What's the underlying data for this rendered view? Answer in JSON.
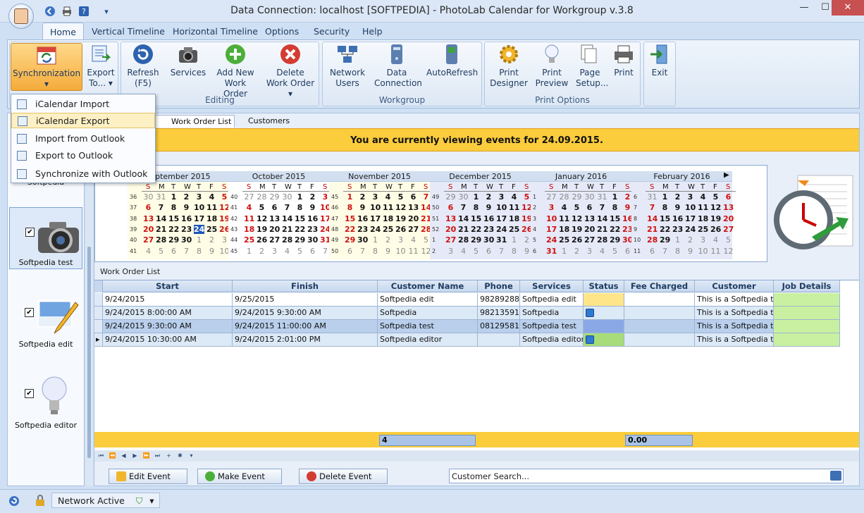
{
  "window": {
    "title": "Data Connection: localhost [SOFTPEDIA] - PhotoLab Calendar for Workgroup v.3.8",
    "minimize": "—",
    "maximize": "☐",
    "close": "✕"
  },
  "menu_tabs": [
    "Home",
    "Vertical Timeline",
    "Horizontal Timeline",
    "Options",
    "Security",
    "Help"
  ],
  "ribbon": {
    "buttons": {
      "sync": "Synchronization",
      "export": "Export To...",
      "refresh": "Refresh (F5)",
      "services": "Services",
      "add_work_order": "Add New Work Order",
      "delete_work_order": "Delete Work Order",
      "network_users": "Network Users",
      "data_connection": "Data Connection",
      "autorefresh": "AutoRefresh",
      "print_designer": "Print Designer",
      "print_preview": "Print Preview",
      "page_setup": "Page Setup...",
      "print": "Print",
      "exit": "Exit"
    },
    "groups": {
      "editing": "Editing",
      "workgroup": "Workgroup",
      "print_options": "Print Options"
    }
  },
  "dropdown": [
    "iCalendar Import",
    "iCalendar Export",
    "Import from Outlook",
    "Export to Outlook",
    "Synchronize with Outlook"
  ],
  "left_panel": [
    {
      "label": "Softpedia",
      "checked": true
    },
    {
      "label": "Softpedia test",
      "checked": true
    },
    {
      "label": "Softpedia edit",
      "checked": true
    },
    {
      "label": "Softpedia editor",
      "checked": true
    }
  ],
  "doc_tabs": [
    "Work Order List",
    "Customers"
  ],
  "banner": "You are currently viewing events for 24.09.2015.",
  "calendar": {
    "weekdays": [
      "S",
      "M",
      "T",
      "W",
      "T",
      "F",
      "S"
    ],
    "months": [
      {
        "name": "September 2015",
        "first_dow": 2,
        "days": 30,
        "first_week": 36,
        "prev_days": 31
      },
      {
        "name": "October 2015",
        "first_dow": 4,
        "days": 31,
        "first_week": 40,
        "prev_days": 30
      },
      {
        "name": "November 2015",
        "first_dow": 0,
        "days": 30,
        "first_week": 45,
        "prev_days": 31
      },
      {
        "name": "December 2015",
        "first_dow": 2,
        "days": 31,
        "first_week": 49,
        "prev_days": 30
      },
      {
        "name": "January 2016",
        "first_dow": 5,
        "days": 31,
        "first_week": 1,
        "prev_days": 31
      },
      {
        "name": "February 2016",
        "first_dow": 1,
        "days": 29,
        "first_week": 6,
        "prev_days": 31
      }
    ],
    "today": {
      "month": 0,
      "day": 24
    }
  },
  "grid": {
    "title": "Work Order List",
    "columns": [
      "Start",
      "Finish",
      "Customer Name",
      "Phone",
      "Services",
      "Status",
      "Fee Charged",
      "Customer Details",
      "Job Details"
    ],
    "rows": [
      {
        "start": "9/24/2015",
        "finish": "9/25/2015",
        "customer": "Softpedia edit",
        "phone": "98289288",
        "services": "Softpedia edit",
        "status": "",
        "fee": "",
        "details": "This is a Softpedia test",
        "job": ""
      },
      {
        "start": "9/24/2015 8:00:00 AM",
        "finish": "9/24/2015 9:30:00 AM",
        "customer": "Softpedia",
        "phone": "98213591",
        "services": "Softpedia",
        "status": "icon",
        "fee": "",
        "details": "This is a Softpedia test",
        "job": ""
      },
      {
        "start": "9/24/2015 9:30:00 AM",
        "finish": "9/24/2015 11:00:00 AM",
        "customer": "Softpedia test",
        "phone": "081295819",
        "services": "Softpedia test",
        "status": "",
        "fee": "",
        "details": "This is a Softpedia test",
        "job": ""
      },
      {
        "start": "9/24/2015 10:30:00 AM",
        "finish": "9/24/2015 2:01:00 PM",
        "customer": "Softpedia editor",
        "phone": "",
        "services": "Softpedia editor",
        "status": "icon",
        "fee": "",
        "details": "This is a Softpedia test",
        "job": ""
      }
    ],
    "footer_count": "4",
    "footer_fee": "0.00"
  },
  "actions": {
    "edit": "Edit Event",
    "make": "Make Event",
    "delete": "Delete Event",
    "search": "Customer Search..."
  },
  "status": {
    "network": "Network Active"
  }
}
